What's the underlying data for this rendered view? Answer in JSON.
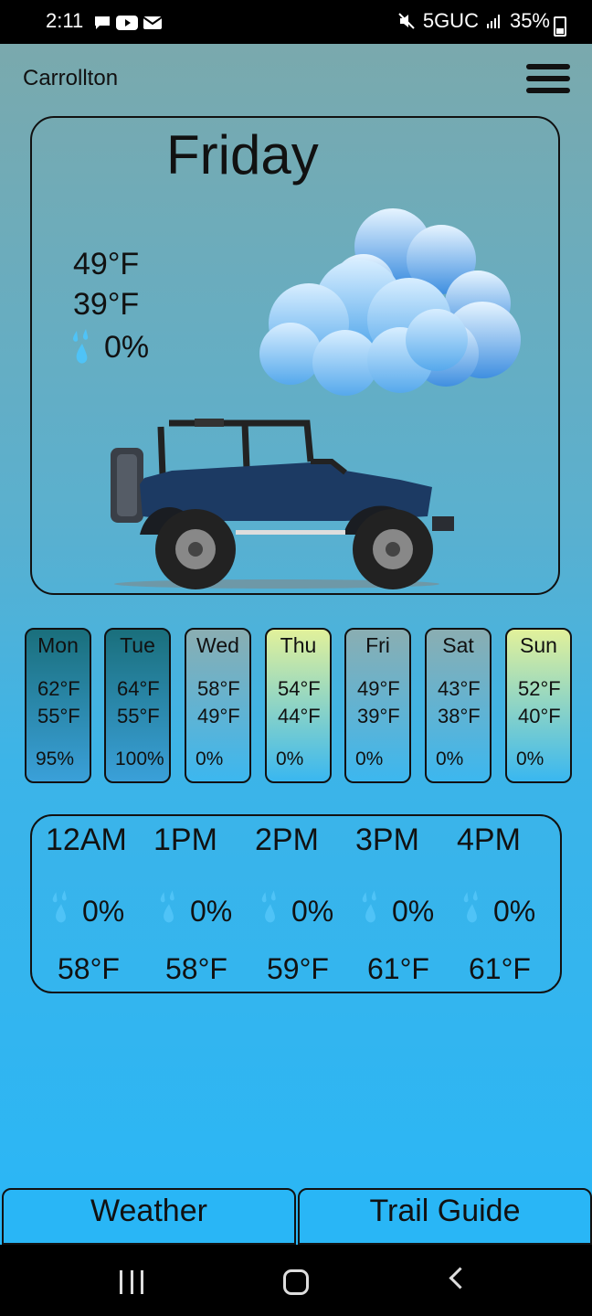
{
  "status_bar": {
    "time": "2:11",
    "network": "5GUC",
    "battery": "35%"
  },
  "header": {
    "location": "Carrollton"
  },
  "today": {
    "day": "Friday",
    "high": "49°F",
    "low": "39°F",
    "precip": "0%"
  },
  "forecast": [
    {
      "day": "Mon",
      "high": "62°F",
      "low": "55°F",
      "precip": "95%",
      "bg_top": "#1a6f7c",
      "bg_bottom": "#3aa0d9"
    },
    {
      "day": "Tue",
      "high": "64°F",
      "low": "55°F",
      "precip": "100%",
      "bg_top": "#1a6f7c",
      "bg_bottom": "#3aa0d9"
    },
    {
      "day": "Wed",
      "high": "58°F",
      "low": "49°F",
      "precip": "0%",
      "bg_top": "#8aaeb2",
      "bg_bottom": "#3cb7ef"
    },
    {
      "day": "Thu",
      "high": "54°F",
      "low": "44°F",
      "precip": "0%",
      "bg_top": "#e2f19a",
      "bg_bottom": "#39b7f0"
    },
    {
      "day": "Fri",
      "high": "49°F",
      "low": "39°F",
      "precip": "0%",
      "bg_top": "#8aaeb2",
      "bg_bottom": "#3cb7ef"
    },
    {
      "day": "Sat",
      "high": "43°F",
      "low": "38°F",
      "precip": "0%",
      "bg_top": "#8aaeb2",
      "bg_bottom": "#3cb7ef"
    },
    {
      "day": "Sun",
      "high": "52°F",
      "low": "40°F",
      "precip": "0%",
      "bg_top": "#e2f19a",
      "bg_bottom": "#39b7f0"
    }
  ],
  "hourly": [
    {
      "time": "12AM",
      "precip": "0%",
      "temp": "58°F"
    },
    {
      "time": "1PM",
      "precip": "0%",
      "temp": "58°F"
    },
    {
      "time": "2PM",
      "precip": "0%",
      "temp": "59°F"
    },
    {
      "time": "3PM",
      "precip": "0%",
      "temp": "61°F"
    },
    {
      "time": "4PM",
      "precip": "0%",
      "temp": "61°F"
    }
  ],
  "tabs": {
    "weather": "Weather",
    "trail_guide": "Trail Guide"
  },
  "colors": {
    "accent": "#29b6f6",
    "drop": "#4fc3f7",
    "jeep_body": "#1c3a63"
  }
}
